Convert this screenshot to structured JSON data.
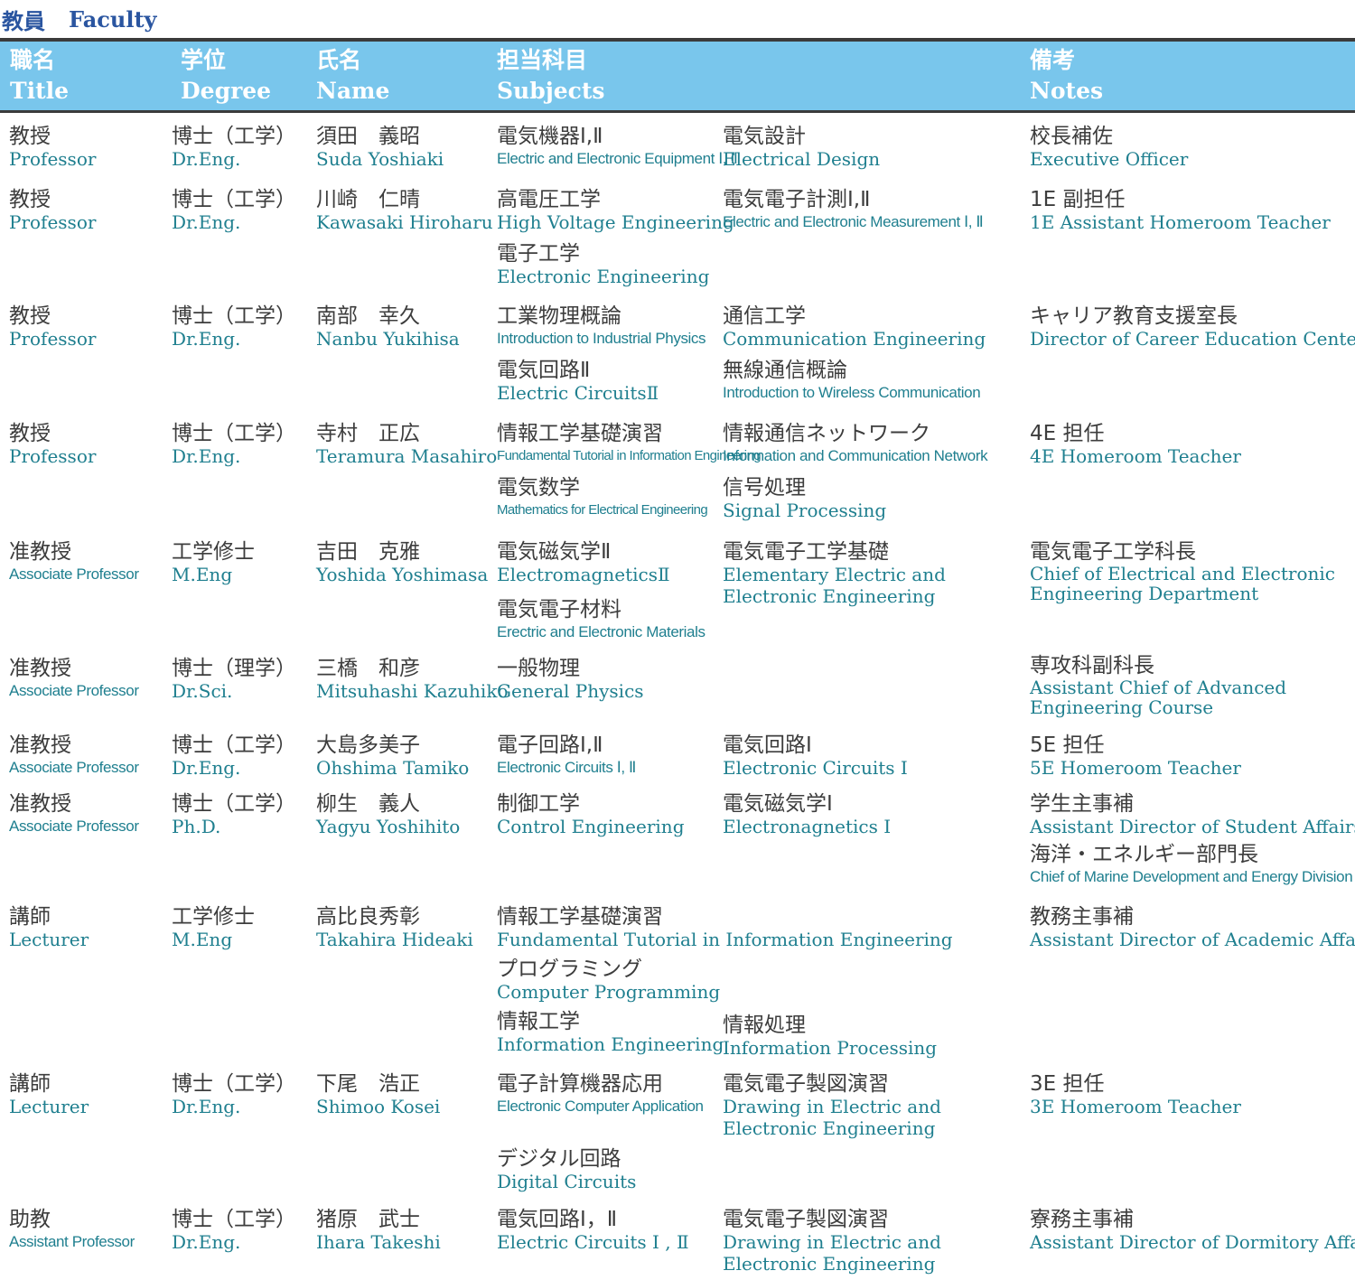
{
  "page": {
    "title_jp": "教員",
    "title_en": "Faculty"
  },
  "header": {
    "title_jp": "職名",
    "title_en": "Title",
    "degree_jp": "学位",
    "degree_en": "Degree",
    "name_jp": "氏名",
    "name_en": "Name",
    "subjects_jp": "担当科目",
    "subjects_en": "Subjects",
    "notes_jp": "備考",
    "notes_en": "Notes"
  },
  "rows": [
    {
      "title_jp": "教授",
      "title_en": "Professor",
      "degree_jp": "博士（工学）",
      "degree_en": "Dr.Eng.",
      "name_jp": "須田　義昭",
      "name_en": "Suda Yoshiaki",
      "subjects": [
        {
          "jp": "電気機器Ⅰ,Ⅱ",
          "en": "Electric and Electronic Equipment Ⅰ, Ⅱ"
        },
        {
          "jp": "電気設計",
          "en": "Electrical Design"
        }
      ],
      "notes": [
        {
          "jp": "校長補佐",
          "en": "Executive Officer"
        }
      ]
    },
    {
      "title_jp": "教授",
      "title_en": "Professor",
      "degree_jp": "博士（工学）",
      "degree_en": "Dr.Eng.",
      "name_jp": "川崎　仁晴",
      "name_en": "Kawasaki Hiroharu",
      "subjects": [
        {
          "jp": "高電圧工学",
          "en": "High Voltage Engineering"
        },
        {
          "jp": "電気電子計測Ⅰ,Ⅱ",
          "en": "Electric and Electronic Measurement Ⅰ, Ⅱ"
        },
        {
          "jp": "電子工学",
          "en": "Electronic Engineering"
        }
      ],
      "notes": [
        {
          "jp": "1E 副担任",
          "en": "1E Assistant Homeroom Teacher"
        }
      ]
    },
    {
      "title_jp": "教授",
      "title_en": "Professor",
      "degree_jp": "博士（工学）",
      "degree_en": "Dr.Eng.",
      "name_jp": "南部　幸久",
      "name_en": "Nanbu Yukihisa",
      "subjects": [
        {
          "jp": "工業物理概論",
          "en": "Introduction to Industrial Physics"
        },
        {
          "jp": "通信工学",
          "en": "Communication Engineering"
        },
        {
          "jp": "電気回路Ⅱ",
          "en": "Electric CircuitsⅡ"
        },
        {
          "jp": "無線通信概論",
          "en": "Introduction to Wireless Communication"
        }
      ],
      "notes": [
        {
          "jp": "キャリア教育支援室長",
          "en": "Director of Career Education Center"
        }
      ]
    },
    {
      "title_jp": "教授",
      "title_en": "Professor",
      "degree_jp": "博士（工学）",
      "degree_en": "Dr.Eng.",
      "name_jp": "寺村　正広",
      "name_en": "Teramura Masahiro",
      "subjects": [
        {
          "jp": "情報工学基礎演習",
          "en": "Fundamental Tutorial in Information Engineering"
        },
        {
          "jp": "情報通信ネットワーク",
          "en": "Information and Communication Network"
        },
        {
          "jp": "電気数学",
          "en": "Mathematics for Electrical Engineering"
        },
        {
          "jp": "信号処理",
          "en": "Signal Processing"
        }
      ],
      "notes": [
        {
          "jp": "4E 担任",
          "en": "4E Homeroom Teacher"
        }
      ]
    },
    {
      "title_jp": "准教授",
      "title_en": "Associate Professor",
      "degree_jp": "工学修士",
      "degree_en": "M.Eng",
      "name_jp": "吉田　克雅",
      "name_en": "Yoshida Yoshimasa",
      "subjects": [
        {
          "jp": "電気磁気学Ⅱ",
          "en": "ElectromagneticsⅡ"
        },
        {
          "jp": "電気電子工学基礎",
          "en": "Elementary Electric and Electronic Engineering"
        },
        {
          "jp": "電気電子材料",
          "en": "Erectric and Electronic Materials"
        }
      ],
      "notes": [
        {
          "jp": "電気電子工学科長",
          "en": "Chief of Electrical and Electronic Engineering Department"
        }
      ]
    },
    {
      "title_jp": "准教授",
      "title_en": "Associate Professor",
      "degree_jp": "博士（理学）",
      "degree_en": "Dr.Sci.",
      "name_jp": "三橋　和彦",
      "name_en": "Mitsuhashi Kazuhiko",
      "subjects": [
        {
          "jp": "一般物理",
          "en": "General Physics"
        }
      ],
      "notes": [
        {
          "jp": "専攻科副科長",
          "en": "Assistant Chief of Advanced Engineering Course"
        }
      ]
    },
    {
      "title_jp": "准教授",
      "title_en": "Associate Professor",
      "degree_jp": "博士（工学）",
      "degree_en": "Dr.Eng.",
      "name_jp": "大島多美子",
      "name_en": "Ohshima Tamiko",
      "subjects": [
        {
          "jp": "電子回路Ⅰ,Ⅱ",
          "en": "Electronic Circuits Ⅰ, Ⅱ"
        },
        {
          "jp": "電気回路Ⅰ",
          "en": "Electronic Circuits Ⅰ"
        }
      ],
      "notes": [
        {
          "jp": "5E 担任",
          "en": "5E Homeroom Teacher"
        }
      ]
    },
    {
      "title_jp": "准教授",
      "title_en": "Associate Professor",
      "degree_jp": "博士（工学）",
      "degree_en": "Ph.D.",
      "name_jp": "柳生　義人",
      "name_en": "Yagyu Yoshihito",
      "subjects": [
        {
          "jp": "制御工学",
          "en": "Control Engineering"
        },
        {
          "jp": "電気磁気学Ⅰ",
          "en": "Electronagnetics Ⅰ"
        }
      ],
      "notes": [
        {
          "jp": "学生主事補",
          "en": "Assistant Director of Student Affairs"
        },
        {
          "jp": "海洋・エネルギー部門長",
          "en": "Chief of Marine Development and Energy Division"
        }
      ]
    },
    {
      "title_jp": "講師",
      "title_en": "Lecturer",
      "degree_jp": "工学修士",
      "degree_en": "M.Eng",
      "name_jp": "高比良秀彰",
      "name_en": "Takahira Hideaki",
      "subjects": [
        {
          "jp": "情報工学基礎演習",
          "en": "Fundamental Tutorial in Information Engineering"
        },
        {
          "jp": "プログラミング",
          "en": "Computer Programming"
        },
        {
          "jp": "情報工学",
          "en": "Information Engineering"
        },
        {
          "jp": "情報処理",
          "en": "Information Processing"
        }
      ],
      "notes": [
        {
          "jp": "教務主事補",
          "en": "Assistant Director of Academic Affairs"
        }
      ]
    },
    {
      "title_jp": "講師",
      "title_en": "Lecturer",
      "degree_jp": "博士（工学）",
      "degree_en": "Dr.Eng.",
      "name_jp": "下尾　浩正",
      "name_en": "Shimoo Kosei",
      "subjects": [
        {
          "jp": "電子計算機器応用",
          "en": "Electronic Computer Application"
        },
        {
          "jp": "電気電子製図演習",
          "en": "Drawing in Electric and Electronic Engineering"
        },
        {
          "jp": "デジタル回路",
          "en": "Digital Circuits"
        }
      ],
      "notes": [
        {
          "jp": "3E 担任",
          "en": "3E Homeroom Teacher"
        }
      ]
    },
    {
      "title_jp": "助教",
      "title_en": "Assistant Professor",
      "degree_jp": "博士（工学）",
      "degree_en": "Dr.Eng.",
      "name_jp": "猪原　武士",
      "name_en": "Ihara Takeshi",
      "subjects": [
        {
          "jp": "電気回路Ⅰ，Ⅱ",
          "en": "Electric Circuits Ⅰ , Ⅱ"
        },
        {
          "jp": "電気電子製図演習",
          "en": "Drawing in Electric and Electronic Engineering"
        }
      ],
      "notes": [
        {
          "jp": "寮務主事補",
          "en": "Assistant Director of Dormitory Affairs"
        }
      ]
    }
  ],
  "colors": {
    "accent": "#2a55a0",
    "header_bg": "#79c6ec",
    "english_text": "#1f7f8f",
    "japanese_text": "#3d3d3d",
    "rule": "#3b3b3b"
  }
}
